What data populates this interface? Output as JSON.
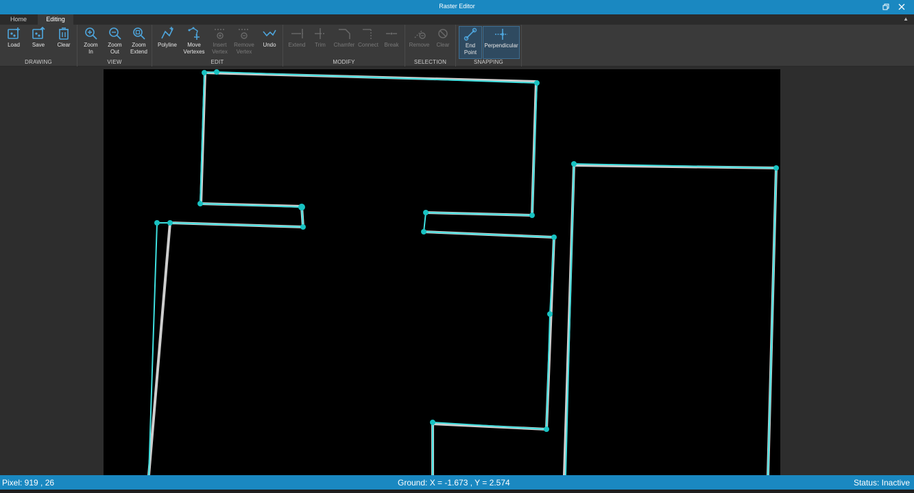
{
  "window": {
    "title": "Raster Editor",
    "restore_icon": "restore-icon",
    "close_icon": "close-icon"
  },
  "tabs": [
    {
      "label": "Home"
    },
    {
      "label": "Editing",
      "active": true
    }
  ],
  "ribbon": {
    "groups": {
      "drawing": "DRAWING",
      "view": "VIEW",
      "edit": "EDIT",
      "modify": "MODIFY",
      "selection": "SELECTION",
      "snapping": "SNAPPING"
    },
    "tools": {
      "load": "Load",
      "save": "Save",
      "clear_drawing": "Clear",
      "zoom_in_1": "Zoom",
      "zoom_in_2": "In",
      "zoom_out_1": "Zoom",
      "zoom_out_2": "Out",
      "zoom_extend_1": "Zoom",
      "zoom_extend_2": "Extend",
      "polyline": "Polyline",
      "move_vertexes_1": "Move",
      "move_vertexes_2": "Vertexes",
      "insert_vertex_1": "Insert",
      "insert_vertex_2": "Vertex",
      "remove_vertex_1": "Remove",
      "remove_vertex_2": "Vertex",
      "undo": "Undo",
      "extend": "Extend",
      "trim": "Trim",
      "chamfer": "Chamfer",
      "connect": "Connect",
      "break": "Break",
      "remove_selection": "Remove",
      "clear_selection": "Clear",
      "end_point_1": "End",
      "end_point_2": "Point",
      "perpendicular": "Perpendicular"
    }
  },
  "colors": {
    "accent": "#1a88c1",
    "line": "#3fe0e0",
    "vertex": "#18c2c2",
    "canvas": "#000000"
  },
  "status": {
    "pixel": "Pixel: 919 , 26",
    "ground": "Ground: X = -1.673 , Y = 2.574",
    "state": "Status: Inactive"
  }
}
